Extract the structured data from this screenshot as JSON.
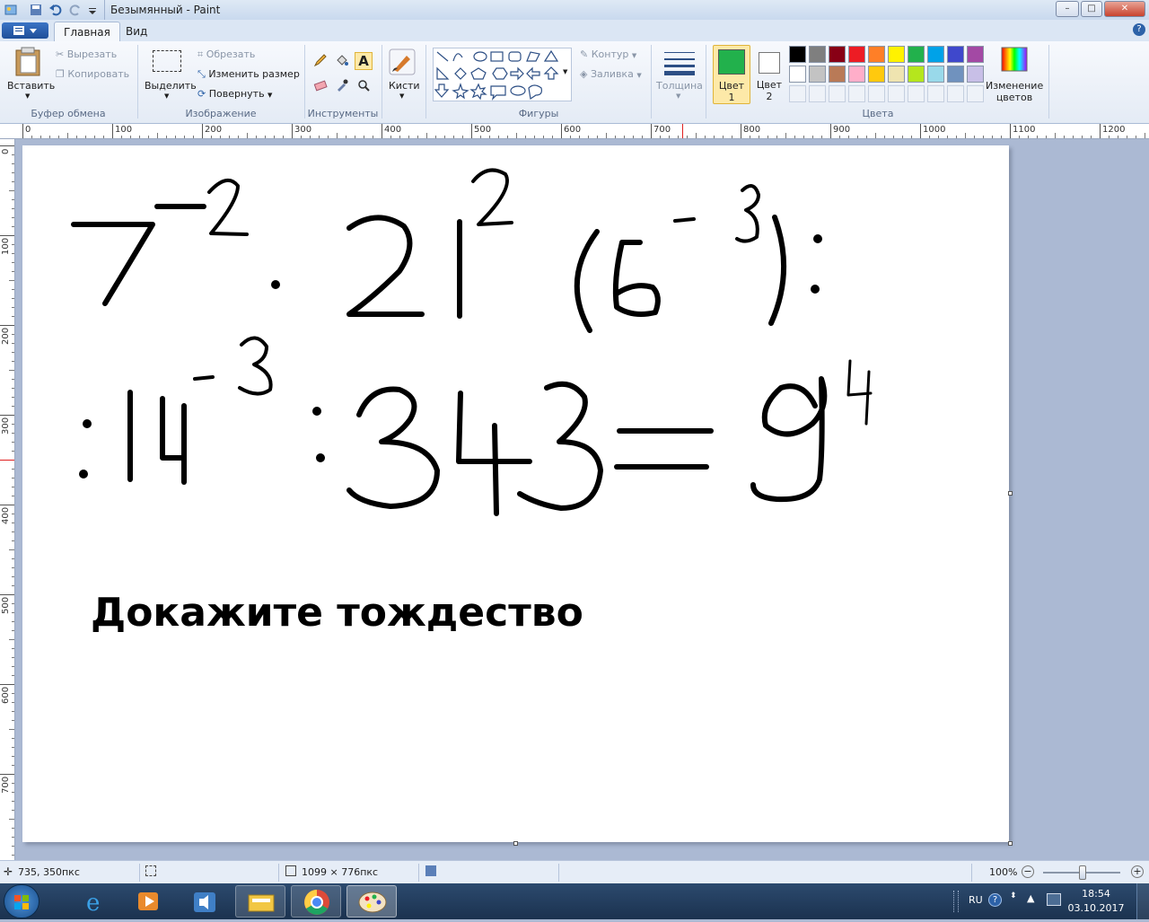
{
  "window": {
    "title": "Безымянный - Paint"
  },
  "tabs": {
    "file": "",
    "home": "Главная",
    "view": "Вид"
  },
  "ribbon": {
    "clipboard": {
      "paste": "Вставить",
      "cut": "Вырезать",
      "copy": "Копировать",
      "label": "Буфер обмена"
    },
    "image": {
      "select": "Выделить",
      "crop": "Обрезать",
      "resize": "Изменить размер",
      "rotate": "Повернуть",
      "label": "Изображение"
    },
    "tools": {
      "label": "Инструменты",
      "brushes": "Кисти"
    },
    "shapes": {
      "outline": "Контур",
      "fill": "Заливка",
      "label": "Фигуры"
    },
    "size": {
      "label": "Толщина"
    },
    "colors": {
      "color1_line1": "Цвет",
      "color1_line2": "1",
      "color2_line1": "Цвет",
      "color2_line2": "2",
      "edit_line1": "Изменение",
      "edit_line2": "цветов",
      "label": "Цвета",
      "color1": "#22b14c",
      "color2": "#ffffff",
      "palette_row1": [
        "#000000",
        "#7f7f7f",
        "#880015",
        "#ed1c24",
        "#ff7f27",
        "#fff200",
        "#22b14c",
        "#00a2e8",
        "#3f48cc",
        "#a349a4"
      ],
      "palette_row2": [
        "#ffffff",
        "#c3c3c3",
        "#b97a57",
        "#ffaec9",
        "#ffc90e",
        "#efe4b0",
        "#b5e61d",
        "#99d9ea",
        "#7092be",
        "#c8bfe7"
      ]
    }
  },
  "ruler": {
    "top": [
      "0",
      "100",
      "200",
      "300",
      "400",
      "500",
      "600",
      "700",
      "800",
      "900",
      "1000",
      "1100",
      "1200"
    ],
    "left": [
      "0",
      "100",
      "200",
      "300",
      "400",
      "500",
      "600",
      "700"
    ]
  },
  "canvas": {
    "caption": "Докажите тождество"
  },
  "status": {
    "cursor": "735, 350пкс",
    "size": "1099 × 776пкс",
    "zoom": "100%"
  },
  "taskbar": {
    "lang": "RU",
    "time": "18:54",
    "date": "03.10.2017"
  }
}
